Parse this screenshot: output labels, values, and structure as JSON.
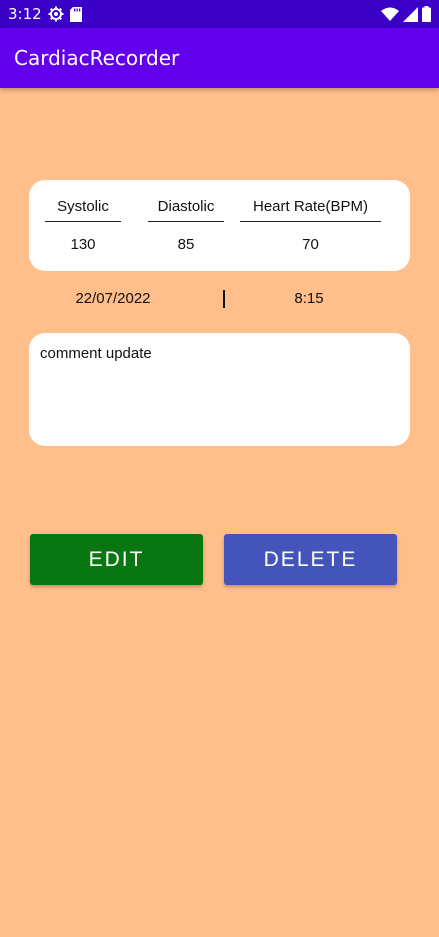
{
  "status_bar": {
    "time": "3:12",
    "icons": [
      "gear-icon",
      "sd-card-icon",
      "wifi-icon",
      "signal-icon",
      "battery-icon"
    ]
  },
  "app_bar": {
    "title": "CardiacRecorder"
  },
  "readings": {
    "systolic": {
      "label": "Systolic",
      "value": "130"
    },
    "diastolic": {
      "label": "Diastolic",
      "value": "85"
    },
    "heart_rate": {
      "label": "Heart Rate(BPM)",
      "value": "70"
    }
  },
  "record": {
    "date": "22/07/2022",
    "time": "8:15"
  },
  "comment": {
    "text": "comment update"
  },
  "actions": {
    "edit_label": "EDIT",
    "delete_label": "DELETE"
  },
  "colors": {
    "background": "#FFBE8A",
    "app_bar": "#6200EE",
    "status_bar": "#3A00C8",
    "edit_button": "#087712",
    "delete_button": "#4355BB"
  }
}
